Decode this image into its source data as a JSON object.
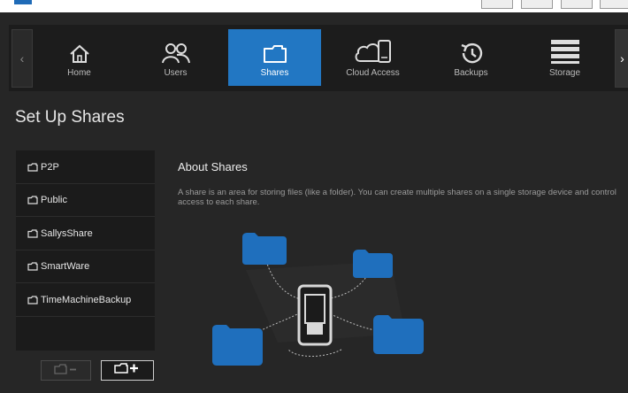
{
  "nav": {
    "items": [
      {
        "label": "Home",
        "icon": "home-icon",
        "active": false
      },
      {
        "label": "Users",
        "icon": "users-icon",
        "active": false
      },
      {
        "label": "Shares",
        "icon": "folder-icon",
        "active": true
      },
      {
        "label": "Cloud Access",
        "icon": "cloud-device-icon",
        "active": false
      },
      {
        "label": "Backups",
        "icon": "history-icon",
        "active": false
      },
      {
        "label": "Storage",
        "icon": "storage-icon",
        "active": false
      }
    ]
  },
  "page": {
    "title": "Set Up Shares"
  },
  "shares": [
    {
      "name": "P2P"
    },
    {
      "name": "Public"
    },
    {
      "name": "SallysShare"
    },
    {
      "name": "SmartWare"
    },
    {
      "name": "TimeMachineBackup"
    }
  ],
  "about": {
    "title": "About Shares",
    "text": "A share is an area for storing files (like a folder). You can create multiple shares on a single storage device and control access to each share."
  },
  "colors": {
    "accent": "#2277c3",
    "folder": "#1f6fbd",
    "background": "#262626",
    "panel": "#1b1b1b"
  }
}
